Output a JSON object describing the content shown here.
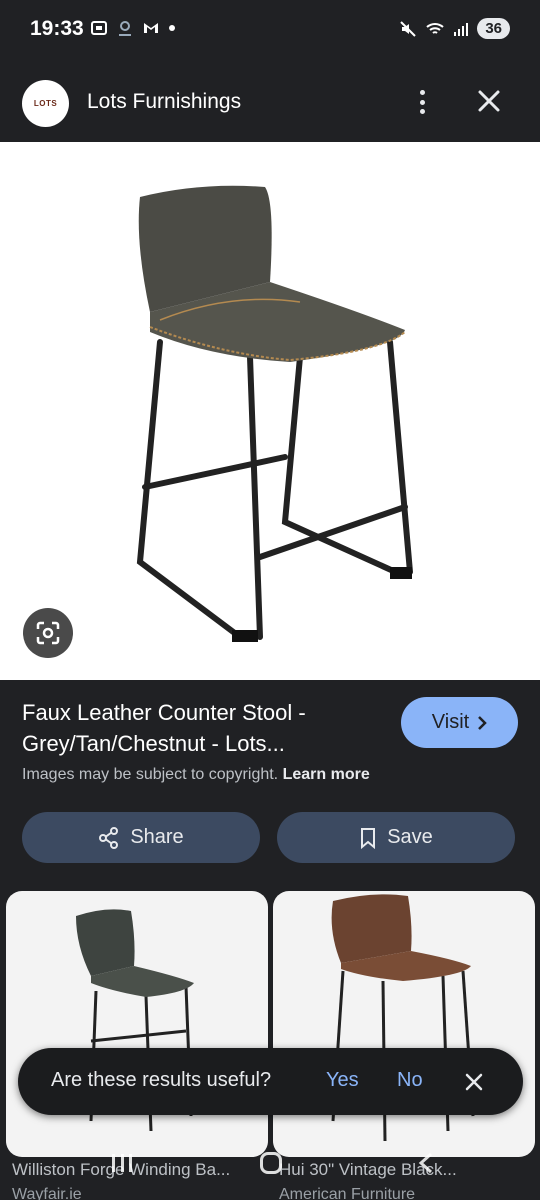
{
  "status_bar": {
    "time": "19:33",
    "left_icons": [
      "screenshot-icon",
      "vpn-icon",
      "gmail-icon",
      "dot-icon"
    ],
    "battery": "36"
  },
  "header": {
    "logo_text": "LOTS",
    "site_name": "Lots Furnishings"
  },
  "result": {
    "title": "Faux Leather Counter Stool - Grey/Tan/Chestnut - Lots...",
    "visit_label": "Visit",
    "copyright_text": "Images may be subject to copyright.",
    "learn_more": "Learn more",
    "share_label": "Share",
    "save_label": "Save"
  },
  "related": [
    {
      "title": "Williston Forge Winding Ba...",
      "source": "Wayfair.ie"
    },
    {
      "title": "Hui 30\" Vintage Black...",
      "source": "American Furniture"
    }
  ],
  "feedback": {
    "question": "Are these results useful?",
    "yes": "Yes",
    "no": "No"
  },
  "colors": {
    "background": "#202124",
    "accent": "#8ab4f8",
    "action_button": "#3c4a61"
  }
}
